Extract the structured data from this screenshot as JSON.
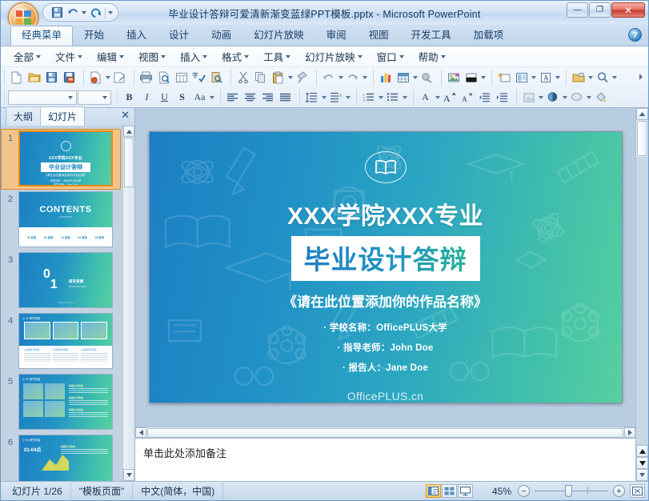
{
  "window": {
    "title": "毕业设计答辩可爱清新渐变蓝绿PPT模板.pptx - Microsoft PowerPoint",
    "minimize_label": "—",
    "maximize_label": "❐",
    "close_label": "✕"
  },
  "quick_access": {
    "items": [
      {
        "name": "save-icon",
        "label": "保存"
      },
      {
        "name": "undo-icon",
        "label": "撤销"
      },
      {
        "name": "redo-icon",
        "label": "恢复"
      },
      {
        "name": "customize-icon",
        "label": "自定义快速访问工具栏"
      }
    ]
  },
  "ribbon": {
    "tabs": [
      {
        "label": "经典菜单",
        "active": true
      },
      {
        "label": "开始",
        "active": false
      },
      {
        "label": "插入",
        "active": false
      },
      {
        "label": "设计",
        "active": false
      },
      {
        "label": "动画",
        "active": false
      },
      {
        "label": "幻灯片放映",
        "active": false
      },
      {
        "label": "审阅",
        "active": false
      },
      {
        "label": "视图",
        "active": false
      },
      {
        "label": "开发工具",
        "active": false
      },
      {
        "label": "加载项",
        "active": false
      }
    ],
    "help_label": "?"
  },
  "classic_menu": {
    "items": [
      {
        "label": "全部"
      },
      {
        "label": "文件"
      },
      {
        "label": "编辑"
      },
      {
        "label": "视图"
      },
      {
        "label": "插入"
      },
      {
        "label": "格式"
      },
      {
        "label": "工具"
      },
      {
        "label": "幻灯片放映"
      },
      {
        "label": "窗口"
      },
      {
        "label": "帮助"
      }
    ]
  },
  "toolbar_row1": {
    "groups": [
      {
        "icons": [
          "new-document-icon",
          "open-folder-icon",
          "save-icon",
          "save-as-icon"
        ]
      },
      {
        "icons": [
          "print-preview-pdf-icon",
          "attach-icon"
        ]
      },
      {
        "icons": [
          "print-icon",
          "print-preview-icon",
          "page-setup-icon",
          "spellcheck-icon",
          "research-icon"
        ]
      },
      {
        "icons": [
          "cut-icon",
          "copy-icon",
          "paste-icon",
          "format-painter-icon"
        ]
      },
      {
        "icons": [
          "undo-icon",
          "redo-icon"
        ]
      },
      {
        "icons": [
          "chart-icon",
          "table-icon",
          "hyperlink-icon"
        ]
      },
      {
        "icons": [
          "picture-icon",
          "color-scheme-icon"
        ]
      },
      {
        "icons": [
          "new-slide-icon",
          "layout-icon",
          "text-style-icon"
        ]
      },
      {
        "icons": [
          "package-icon",
          "zoom-search-icon"
        ]
      }
    ]
  },
  "toolbar_row2": {
    "font_name": "",
    "font_size": "",
    "format_buttons": [
      "B",
      "I",
      "U",
      "S",
      "Aa"
    ],
    "align_icons": [
      "align-left-icon",
      "align-center-icon",
      "align-right-icon",
      "align-justify-icon"
    ],
    "spacing_icons": [
      "line-spacing-icon",
      "paragraph-spacing-icon"
    ],
    "list_icons": [
      "numbered-list-icon",
      "bulleted-list-icon"
    ],
    "font_size_icons": [
      "font-color-icon",
      "increase-font-icon",
      "decrease-font-icon"
    ],
    "indent_icons": [
      "decrease-indent-icon",
      "increase-indent-icon"
    ],
    "object_icons": [
      "slide-design-icon",
      "shadow-icon",
      "shape-fill-icon",
      "fill-color-icon"
    ]
  },
  "slides_pane": {
    "tabs": [
      {
        "label": "幻灯片",
        "active": true
      },
      {
        "label": "大纲",
        "active": false
      }
    ],
    "close_label": "✕",
    "thumbnails": [
      {
        "number": "1",
        "kind": "title",
        "selected": true
      },
      {
        "number": "2",
        "kind": "contents",
        "selected": false
      },
      {
        "number": "3",
        "kind": "section",
        "selected": false
      },
      {
        "number": "4",
        "kind": "three-cards",
        "selected": false
      },
      {
        "number": "5",
        "kind": "grid-photos",
        "selected": false
      },
      {
        "number": "6",
        "kind": "chart",
        "selected": false
      }
    ],
    "thumb_contents": {
      "contents_title": "CONTENTS",
      "section_number_top": "0",
      "section_number_bottom": "1"
    }
  },
  "slide": {
    "icon": "open-book-icon",
    "heading": "XXX学院XXX专业",
    "title": "毕业设计答辩",
    "subtitle": "《请在此位置添加你的作品名称》",
    "bullets": [
      "·  学校名称：OfficePLUS大学",
      "·  指导老师：John Doe",
      "·  报告人：Jane Doe"
    ],
    "brand": "OfficePLUS.cn",
    "colors": {
      "gradient_start": "#1b7fc4",
      "gradient_end": "#57d0a0",
      "title_text": "#ffffff"
    }
  },
  "notes": {
    "placeholder": "单击此处添加备注"
  },
  "status_bar": {
    "slide_count": "幻灯片 1/26",
    "theme_name": "\"模板页面\"",
    "language": "中文(简体，中国)",
    "view_buttons": [
      {
        "name": "normal-view-button",
        "active": true
      },
      {
        "name": "slide-sorter-view-button",
        "active": false
      },
      {
        "name": "slideshow-view-button",
        "active": false
      }
    ],
    "zoom_level": "45%",
    "zoom_out_label": "−",
    "zoom_in_label": "+",
    "fit_button_name": "fit-slide-to-window-button"
  }
}
